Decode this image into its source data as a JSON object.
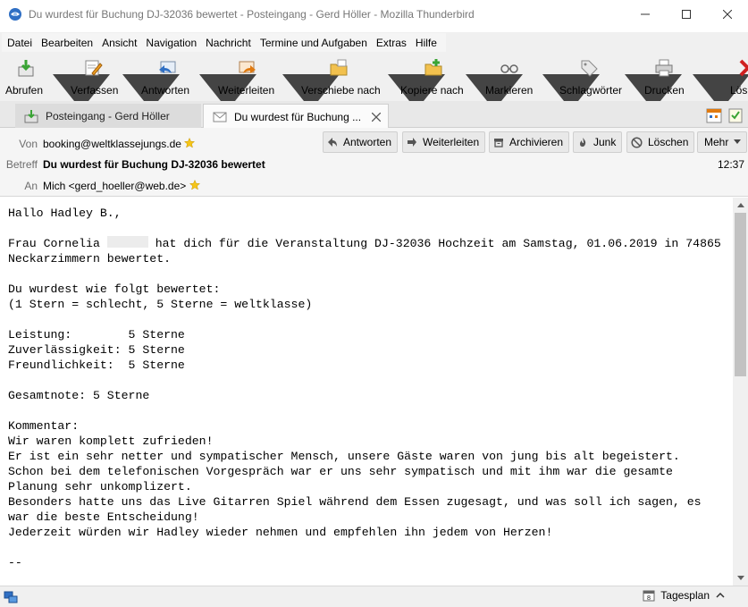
{
  "window": {
    "title": "Du wurdest für Buchung DJ-32036 bewertet - Posteingang - Gerd Höller - Mozilla Thunderbird"
  },
  "menu": [
    "Datei",
    "Bearbeiten",
    "Ansicht",
    "Navigation",
    "Nachricht",
    "Termine und Aufgaben",
    "Extras",
    "Hilfe"
  ],
  "toolbar": {
    "abrufen": "Abrufen",
    "verfassen": "Verfassen",
    "antworten": "Antworten",
    "weiterleiten": "Weiterleiten",
    "verschieben": "Verschiebe nach",
    "kopieren": "Kopiere nach",
    "markieren": "Markieren",
    "schlagwoerter": "Schlagwörter",
    "drucken": "Drucken",
    "loeschen": "Lös"
  },
  "tabs": [
    {
      "label": "Posteingang - Gerd Höller"
    },
    {
      "label": "Du wurdest für Buchung ..."
    }
  ],
  "header": {
    "from_label": "Von",
    "from_value": "booking@weltklassejungs.de",
    "subject_label": "Betreff",
    "subject_value": "Du wurdest für Buchung DJ-32036 bewertet",
    "time": "12:37",
    "to_label": "An",
    "to_value": "Mich <gerd_hoeller@web.de>",
    "buttons": {
      "reply": "Antworten",
      "forward": "Weiterleiten",
      "archive": "Archivieren",
      "junk": "Junk",
      "delete": "Löschen",
      "more": "Mehr"
    }
  },
  "body": {
    "greeting": "Hallo Hadley B.,",
    "line1a": "Frau Cornelia ",
    "line1b": " hat dich für die Veranstaltung DJ-32036 Hochzeit am Samstag, 01.06.2019 in 74865",
    "line2": "Neckarzimmern bewertet.",
    "rated_intro": "Du wurdest wie folgt bewertet:",
    "rated_scale": "(1 Stern = schlecht, 5 Sterne = weltklasse)",
    "rating1": "Leistung:        5 Sterne",
    "rating2": "Zuverlässigkeit: 5 Sterne",
    "rating3": "Freundlichkeit:  5 Sterne",
    "overall": "Gesamtnote: 5 Sterne",
    "comment_label": "Kommentar:",
    "comment1": "Wir waren komplett zufrieden!",
    "comment2": "Er ist ein sehr netter und sympatischer Mensch, unsere Gäste waren von jung bis alt begeistert.",
    "comment3": "Schon bei dem telefonischen Vorgespräch war er uns sehr sympatisch und mit ihm war die gesamte",
    "comment4": "Planung sehr unkomplizert.",
    "comment5": "Besonders hatte uns das Live Gitarren Spiel während dem Essen zugesagt, und was soll ich sagen, es",
    "comment6": "war die beste Entscheidung!",
    "comment7": "Jederzeit würden wir Hadley wieder nehmen und empfehlen ihn jedem von Herzen!",
    "signature": "--"
  },
  "statusbar": {
    "tagesplan": "Tagesplan"
  },
  "colors": {
    "accent_blue": "#2f6fc4",
    "star_yellow": "#f5c518",
    "toolbar_bg": "#f0f0f0"
  }
}
